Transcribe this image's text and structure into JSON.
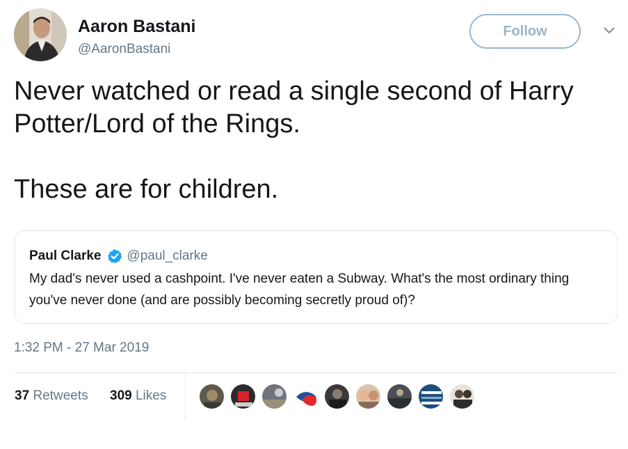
{
  "author": {
    "name": "Aaron Bastani",
    "handle": "@AaronBastani"
  },
  "actions": {
    "follow_label": "Follow",
    "menu_icon": "chevron-down-icon"
  },
  "tweet": {
    "paragraphs": [
      "Never watched or read a single second of Harry Potter/Lord of the Rings.",
      "These are for children."
    ],
    "timestamp": "1:32 PM - 27 Mar 2019"
  },
  "quoted_tweet": {
    "name": "Paul Clarke",
    "verified_icon": "verified-badge-icon",
    "handle": "@paul_clarke",
    "text": "My dad's never used a cashpoint. I've never eaten a Subway. What's the most ordinary thing you've never done (and are possibly becoming secretly proud of)?"
  },
  "stats": {
    "retweets_count": "37",
    "retweets_label": "Retweets",
    "likes_count": "309",
    "likes_label": "Likes"
  },
  "colors": {
    "text": "#14171a",
    "secondary": "#657786",
    "border": "#e1e8ed",
    "follow_border": "#9ab7cc",
    "verified": "#1da1f2"
  }
}
